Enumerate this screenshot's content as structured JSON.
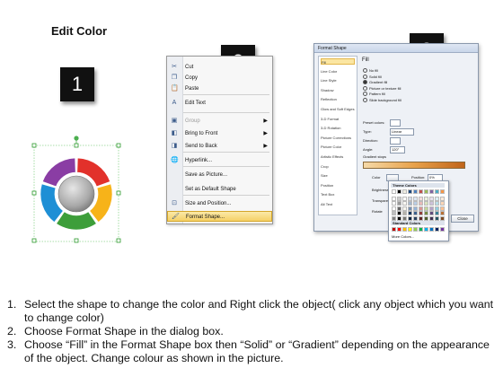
{
  "title": "Edit Color",
  "step_boxes": [
    "1",
    "2",
    "3"
  ],
  "ring_colors": [
    "#e2312b",
    "#f7b319",
    "#3d9e3a",
    "#1e8fd5",
    "#8a3da4"
  ],
  "context_menu": {
    "items": [
      {
        "label": "Cut",
        "icon": "scissors-icon",
        "disabled": false,
        "submenu": false
      },
      {
        "label": "Copy",
        "icon": "copy-icon",
        "disabled": false,
        "submenu": false
      },
      {
        "label": "Paste",
        "icon": "paste-icon",
        "disabled": false,
        "submenu": false
      },
      {
        "label": "Edit Text",
        "icon": "edit-text-icon",
        "disabled": false,
        "submenu": false
      },
      {
        "label": "Group",
        "icon": "group-icon",
        "disabled": true,
        "submenu": true
      },
      {
        "label": "Bring to Front",
        "icon": "bring-front-icon",
        "disabled": false,
        "submenu": true
      },
      {
        "label": "Send to Back",
        "icon": "send-back-icon",
        "disabled": false,
        "submenu": true
      },
      {
        "label": "Hyperlink...",
        "icon": "hyperlink-icon",
        "disabled": false,
        "submenu": false
      },
      {
        "label": "Save as Picture...",
        "icon": "",
        "disabled": false,
        "submenu": false
      },
      {
        "label": "Set as Default Shape",
        "icon": "",
        "disabled": false,
        "submenu": false
      },
      {
        "label": "Size and Position...",
        "icon": "size-icon",
        "disabled": false,
        "submenu": false
      },
      {
        "label": "Format Shape...",
        "icon": "format-shape-icon",
        "disabled": false,
        "submenu": false,
        "selected": true
      }
    ]
  },
  "format_dialog": {
    "title": "Format Shape",
    "nav": [
      "Fill",
      "Line Color",
      "Line Style",
      "Shadow",
      "Reflection",
      "Glow and Soft Edges",
      "3-D Format",
      "3-D Rotation",
      "Picture Corrections",
      "Picture Color",
      "Artistic Effects",
      "Crop",
      "Size",
      "Position",
      "Text Box",
      "Alt Text"
    ],
    "pane_title": "Fill",
    "fill_options": [
      "No fill",
      "Solid fill",
      "Gradient fill",
      "Picture or texture fill",
      "Pattern fill",
      "Slide background fill"
    ],
    "selected_fill": "Gradient fill",
    "fields": {
      "preset_colors": "Preset colors:",
      "type_label": "Type:",
      "type_value": "Linear",
      "direction_label": "Direction:",
      "angle_label": "Angle:",
      "angle_value": "120°",
      "gradient_stops": "Gradient stops",
      "color_label": "Color",
      "position_label": "Position:",
      "position_value": "0%",
      "brightness_label": "Brightness",
      "transparency_label": "Transpare",
      "rotate_label": "Rotate"
    },
    "close_button": "Close",
    "palette": {
      "theme_header": "Theme Colors",
      "standard_header": "Standard Colors",
      "more_colors": "More Colors...",
      "theme_row": [
        "#ffffff",
        "#000000",
        "#eeece1",
        "#1f497d",
        "#4f81bd",
        "#c0504d",
        "#9bbb59",
        "#8064a2",
        "#4bacc6",
        "#f79646"
      ],
      "standard_row": [
        "#c00000",
        "#ff0000",
        "#ffc000",
        "#ffff00",
        "#92d050",
        "#00b050",
        "#00b0f0",
        "#0070c0",
        "#002060",
        "#7030a0"
      ]
    }
  },
  "instructions": [
    {
      "num": "1.",
      "text": "Select the shape to change the color and Right click the object( click any object which you want to change color)"
    },
    {
      "num": "2.",
      "text": "Choose Format Shape in the dialog box."
    },
    {
      "num": "3.",
      "text": "Choose “Fill” in the Format Shape box then “Solid” or “Gradient” depending on the appearance of the object. Change colour as shown in the picture."
    }
  ]
}
